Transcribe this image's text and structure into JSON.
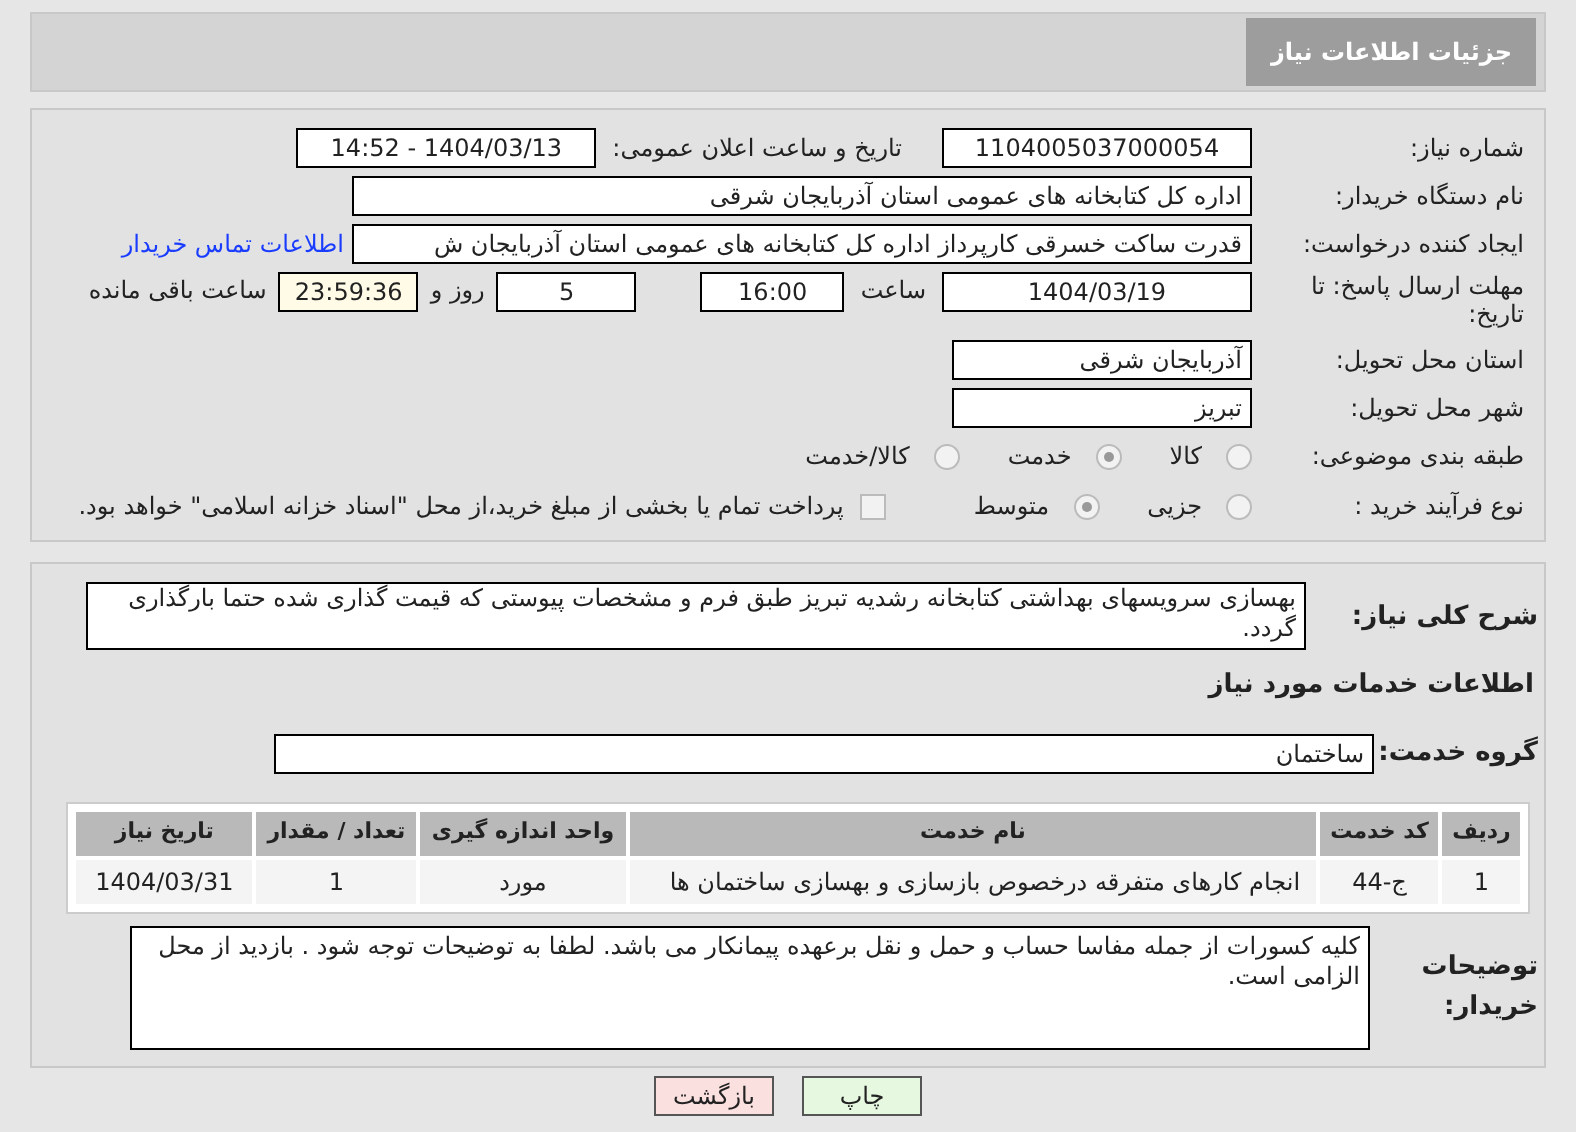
{
  "header": {
    "title": "جزئیات اطلاعات نیاز"
  },
  "need_number": {
    "label": "شماره نیاز:",
    "value": "1104005037000054"
  },
  "announce": {
    "label": "تاریخ و ساعت اعلان عمومی:",
    "value": "1404/03/13 - 14:52"
  },
  "buyer_org": {
    "label": "نام دستگاه خریدار:",
    "value": "اداره کل کتابخانه های عمومی استان آذربایجان شرقی"
  },
  "requester": {
    "label": "ایجاد کننده درخواست:",
    "value": "قدرت ساکت خسرقی کارپرداز اداره کل کتابخانه های عمومی استان آذربایجان ش",
    "link": "اطلاعات تماس خریدار"
  },
  "deadline": {
    "label": "مهلت ارسال پاسخ: تا تاریخ:",
    "date": "1404/03/19",
    "time_label": "ساعت",
    "time": "16:00",
    "days": "5",
    "days_label": "روز و",
    "remaining": "23:59:36",
    "remaining_label": "ساعت باقی مانده"
  },
  "province": {
    "label": "استان محل تحویل:",
    "value": "آذربایجان شرقی"
  },
  "city": {
    "label": "شهر محل تحویل:",
    "value": "تبریز"
  },
  "category": {
    "label": "طبقه بندی موضوعی:",
    "options": [
      {
        "label": "کالا",
        "selected": false
      },
      {
        "label": "خدمت",
        "selected": true
      },
      {
        "label": "کالا/خدمت",
        "selected": false
      }
    ]
  },
  "process": {
    "label": "نوع فرآیند خرید :",
    "options": [
      {
        "label": "جزیی",
        "selected": false
      },
      {
        "label": "متوسط",
        "selected": true
      }
    ],
    "checkbox": {
      "label": "پرداخت تمام یا بخشی از مبلغ خرید،از محل \"اسناد خزانه اسلامی\" خواهد بود.",
      "checked": false
    }
  },
  "description": {
    "label": "شرح کلی نیاز:",
    "value": "بهسازی سرویسهای بهداشتی کتابخانه رشدیه تبریز طبق فرم و مشخصات پیوستی که قیمت گذاری شده حتما بارگذاری گردد."
  },
  "services_title": "اطلاعات خدمات مورد نیاز",
  "service_group": {
    "label": "گروه خدمت:",
    "value": "ساختمان"
  },
  "table": {
    "columns": [
      "ردیف",
      "کد خدمت",
      "نام خدمت",
      "واحد اندازه گیری",
      "تعداد / مقدار",
      "تاریخ نیاز"
    ],
    "rows": [
      [
        "1",
        "ج-44",
        "انجام کارهای متفرقه درخصوص بازسازی و بهسازی ساختمان ها",
        "مورد",
        "1",
        "1404/03/31"
      ]
    ]
  },
  "buyer_notes": {
    "label": "توضیحات خریدار:",
    "value": "کلیه کسورات از جمله مفاسا حساب و حمل و نقل برعهده پیمانکار می باشد. لطفا به توضیحات توجه شود . بازدید از محل الزامی است."
  },
  "buttons": [
    {
      "label": "چاپ",
      "kind": "print"
    },
    {
      "label": "بازگشت",
      "kind": "back"
    }
  ]
}
